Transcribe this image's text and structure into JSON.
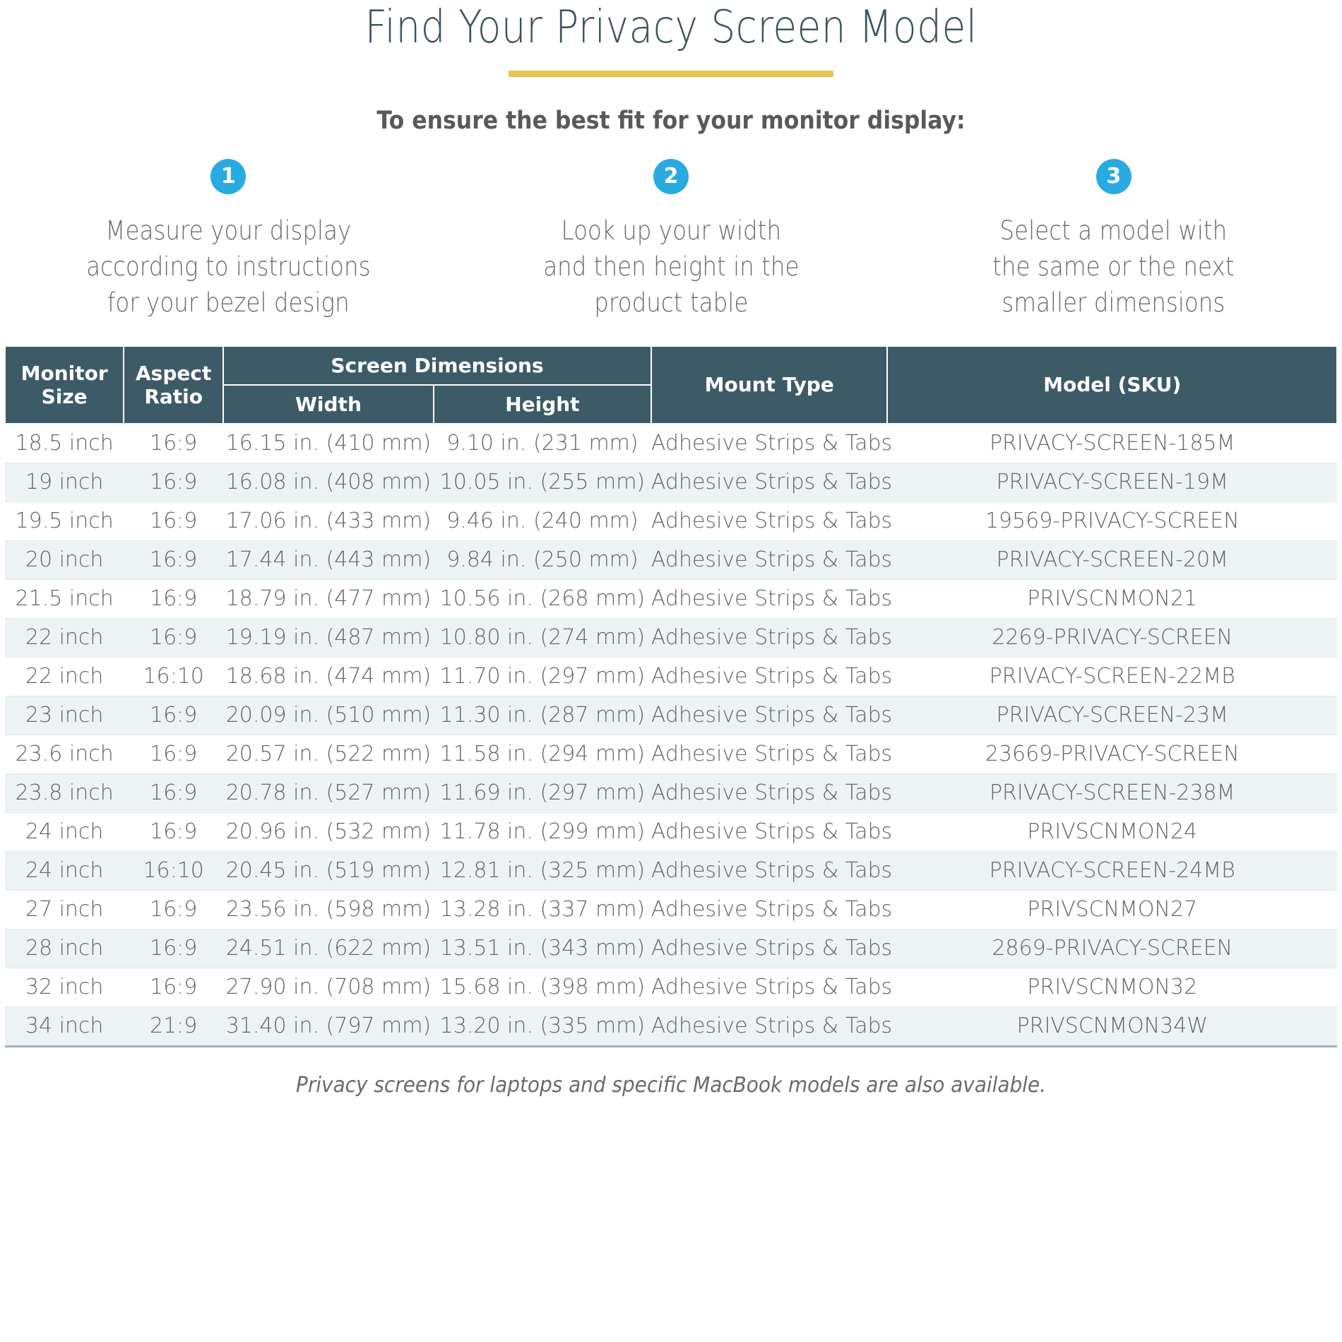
{
  "header": {
    "title": "Find Your Privacy Screen Model",
    "accent_color": "#e8c44d",
    "title_color": "#3b5561",
    "subtitle": "To ensure the best fit for your monitor display:"
  },
  "steps": {
    "badge_color": "#29abe2",
    "items": [
      {
        "number": "1",
        "text": "Measure your display\naccording to instructions\nfor your bezel design"
      },
      {
        "number": "2",
        "text": "Look up your width\nand then height in the\nproduct table"
      },
      {
        "number": "3",
        "text": "Select a model with\nthe same or the next\nsmaller dimensions"
      }
    ]
  },
  "table": {
    "header_bg": "#3d5b67",
    "row_alt_bg": "#edf3f4",
    "group_header": "Screen Dimensions",
    "columns": [
      {
        "key": "size",
        "label": "Monitor\nSize"
      },
      {
        "key": "ratio",
        "label": "Aspect\nRatio"
      },
      {
        "key": "width",
        "label": "Width"
      },
      {
        "key": "height",
        "label": "Height"
      },
      {
        "key": "mount",
        "label": "Mount Type"
      },
      {
        "key": "model",
        "label": "Model (SKU)"
      }
    ],
    "rows": [
      {
        "size": "18.5 inch",
        "ratio": "16:9",
        "width": "16.15 in. (410 mm)",
        "height": "9.10 in. (231 mm)",
        "mount": "Adhesive Strips & Tabs",
        "model": "PRIVACY-SCREEN-185M"
      },
      {
        "size": "19 inch",
        "ratio": "16:9",
        "width": "16.08 in. (408 mm)",
        "height": "10.05 in. (255 mm)",
        "mount": "Adhesive Strips & Tabs",
        "model": "PRIVACY-SCREEN-19M"
      },
      {
        "size": "19.5 inch",
        "ratio": "16:9",
        "width": "17.06 in. (433 mm)",
        "height": "9.46 in. (240 mm)",
        "mount": "Adhesive Strips & Tabs",
        "model": "19569-PRIVACY-SCREEN"
      },
      {
        "size": "20 inch",
        "ratio": "16:9",
        "width": "17.44 in. (443 mm)",
        "height": "9.84 in. (250 mm)",
        "mount": "Adhesive Strips & Tabs",
        "model": "PRIVACY-SCREEN-20M"
      },
      {
        "size": "21.5 inch",
        "ratio": "16:9",
        "width": "18.79 in. (477 mm)",
        "height": "10.56 in. (268 mm)",
        "mount": "Adhesive Strips & Tabs",
        "model": "PRIVSCNMON21"
      },
      {
        "size": "22 inch",
        "ratio": "16:9",
        "width": "19.19 in. (487 mm)",
        "height": "10.80 in. (274 mm)",
        "mount": "Adhesive Strips & Tabs",
        "model": "2269-PRIVACY-SCREEN"
      },
      {
        "size": "22 inch",
        "ratio": "16:10",
        "width": "18.68 in. (474 mm)",
        "height": "11.70 in. (297 mm)",
        "mount": "Adhesive Strips & Tabs",
        "model": "PRIVACY-SCREEN-22MB"
      },
      {
        "size": "23 inch",
        "ratio": "16:9",
        "width": "20.09 in. (510 mm)",
        "height": "11.30 in. (287 mm)",
        "mount": "Adhesive Strips & Tabs",
        "model": "PRIVACY-SCREEN-23M"
      },
      {
        "size": "23.6 inch",
        "ratio": "16:9",
        "width": "20.57 in. (522 mm)",
        "height": "11.58 in. (294 mm)",
        "mount": "Adhesive Strips & Tabs",
        "model": "23669-PRIVACY-SCREEN"
      },
      {
        "size": "23.8 inch",
        "ratio": "16:9",
        "width": "20.78 in. (527 mm)",
        "height": "11.69 in. (297 mm)",
        "mount": "Adhesive Strips & Tabs",
        "model": "PRIVACY-SCREEN-238M"
      },
      {
        "size": "24 inch",
        "ratio": "16:9",
        "width": "20.96 in. (532 mm)",
        "height": "11.78 in. (299 mm)",
        "mount": "Adhesive Strips & Tabs",
        "model": "PRIVSCNMON24"
      },
      {
        "size": "24 inch",
        "ratio": "16:10",
        "width": "20.45 in. (519 mm)",
        "height": "12.81 in. (325 mm)",
        "mount": "Adhesive Strips & Tabs",
        "model": "PRIVACY-SCREEN-24MB"
      },
      {
        "size": "27 inch",
        "ratio": "16:9",
        "width": "23.56 in. (598 mm)",
        "height": "13.28 in. (337 mm)",
        "mount": "Adhesive Strips & Tabs",
        "model": "PRIVSCNMON27"
      },
      {
        "size": "28 inch",
        "ratio": "16:9",
        "width": "24.51 in. (622 mm)",
        "height": "13.51 in. (343 mm)",
        "mount": "Adhesive Strips & Tabs",
        "model": "2869-PRIVACY-SCREEN"
      },
      {
        "size": "32 inch",
        "ratio": "16:9",
        "width": "27.90 in. (708 mm)",
        "height": "15.68 in. (398 mm)",
        "mount": "Adhesive Strips & Tabs",
        "model": "PRIVSCNMON32"
      },
      {
        "size": "34 inch",
        "ratio": "21:9",
        "width": "31.40 in. (797 mm)",
        "height": "13.20 in. (335 mm)",
        "mount": "Adhesive Strips & Tabs",
        "model": "PRIVSCNMON34W"
      }
    ]
  },
  "footnote": "Privacy screens for laptops and specific MacBook models are also available."
}
